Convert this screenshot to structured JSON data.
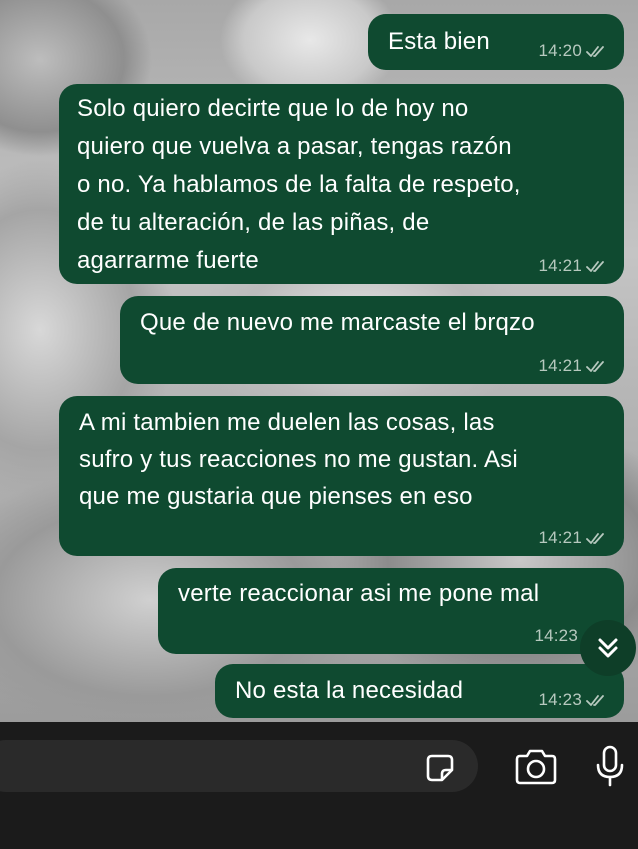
{
  "messages": [
    {
      "text": "Esta bien",
      "time": "14:20"
    },
    {
      "text": "Solo quiero decirte que lo de hoy no\nquiero que vuelva a pasar, tengas razón\no no. Ya hablamos de la falta de respeto,\nde tu alteración, de las piñas, de\nagarrarme fuerte",
      "time": "14:21"
    },
    {
      "text": "Que de nuevo me marcaste el brqzo",
      "time": "14:21"
    },
    {
      "text": "A mi tambien me duelen las cosas, las\nsufro y tus reacciones no me gustan. Asi\nque me gustaria que pienses en eso",
      "time": "14:21"
    },
    {
      "text": "verte reaccionar asi me pone mal",
      "time": "14:23"
    },
    {
      "text": "No esta la necesidad",
      "time": "14:23"
    }
  ],
  "icons": {
    "scroll_down": "double-chevron-down-icon",
    "sticker": "sticker-icon",
    "camera": "camera-icon",
    "mic": "microphone-icon",
    "read_receipt": "double-check-icon"
  },
  "colors": {
    "bubble": "#0f4a30",
    "meta_text": "#b7c9bf",
    "bottom_bar": "#1b1b1b"
  }
}
